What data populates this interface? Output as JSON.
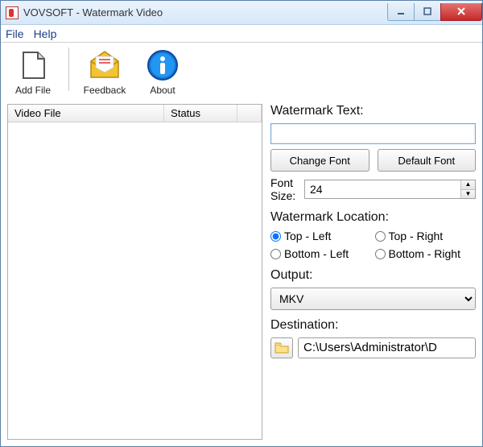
{
  "titlebar": {
    "title": "VOVSOFT - Watermark Video"
  },
  "menubar": {
    "file": "File",
    "help": "Help"
  },
  "toolbar": {
    "add_file": "Add File",
    "feedback": "Feedback",
    "about": "About"
  },
  "filelist": {
    "col_video_file": "Video File",
    "col_status": "Status"
  },
  "panel": {
    "watermark_text_label": "Watermark Text:",
    "watermark_text_value": "",
    "change_font": "Change Font",
    "default_font": "Default Font",
    "font_size_label": "Font Size:",
    "font_size_value": "24",
    "location_label": "Watermark Location:",
    "loc_top_left": "Top - Left",
    "loc_top_right": "Top - Right",
    "loc_bottom_left": "Bottom - Left",
    "loc_bottom_right": "Bottom - Right",
    "location_selected": "top_left",
    "output_label": "Output:",
    "output_value": "MKV",
    "destination_label": "Destination:",
    "destination_path": "C:\\Users\\Administrator\\D"
  }
}
